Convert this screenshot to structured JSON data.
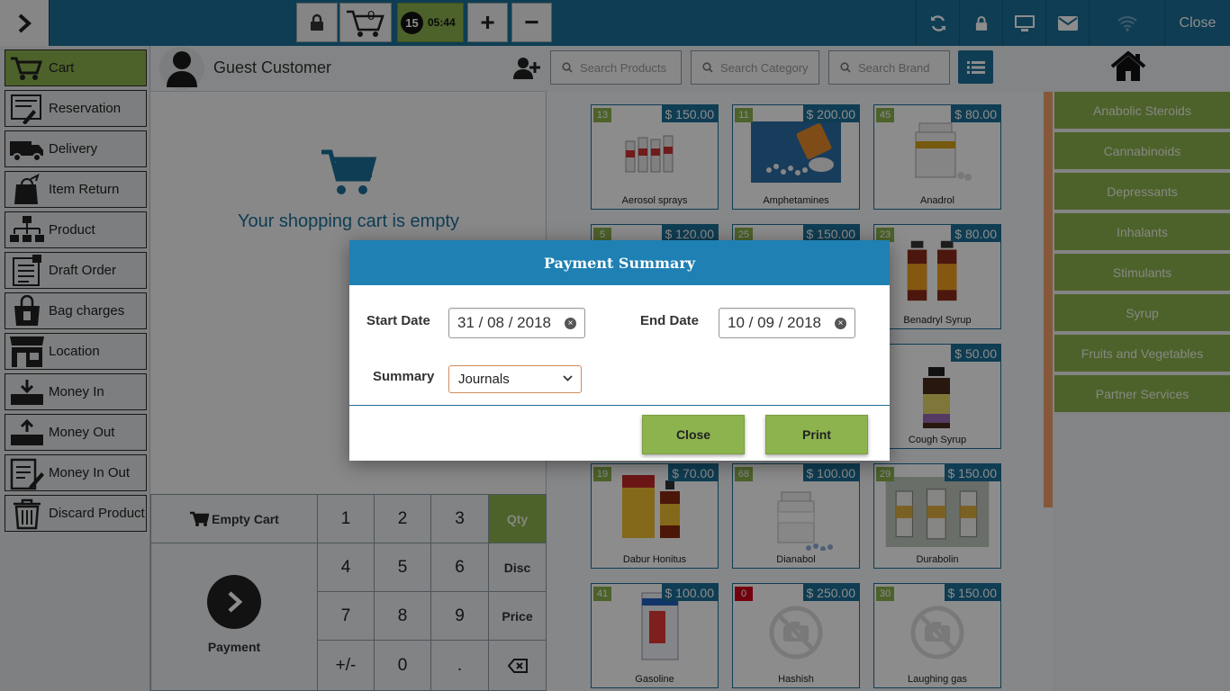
{
  "topbar": {
    "cart_count": "0",
    "order_count": "15",
    "timer": "05:44",
    "plus_label": "+",
    "minus_label": "−",
    "close_label": "Close"
  },
  "sidebar": {
    "items": [
      {
        "label": "Cart",
        "icon": "cart-icon",
        "active": true
      },
      {
        "label": "Reservation",
        "icon": "reservation-icon"
      },
      {
        "label": "Delivery",
        "icon": "delivery-truck-icon"
      },
      {
        "label": "Item Return",
        "icon": "item-return-icon"
      },
      {
        "label": "Product",
        "icon": "product-tree-icon"
      },
      {
        "label": "Draft Order",
        "icon": "draft-order-icon"
      },
      {
        "label": "Bag charges",
        "icon": "bag-icon"
      },
      {
        "label": "Location",
        "icon": "store-icon"
      },
      {
        "label": "Money In",
        "icon": "money-in-icon"
      },
      {
        "label": "Money Out",
        "icon": "money-out-icon"
      },
      {
        "label": "Money In Out",
        "icon": "money-in-out-icon"
      },
      {
        "label": "Discard Product",
        "icon": "trash-icon"
      }
    ]
  },
  "cart": {
    "customer_name": "Guest Customer",
    "empty_message": "Your shopping cart is empty",
    "empty_cart_label": "Empty Cart",
    "payment_label": "Payment"
  },
  "keypad": {
    "keys": [
      "1",
      "2",
      "3",
      "4",
      "5",
      "6",
      "7",
      "8",
      "9",
      "+/-",
      "0",
      "."
    ],
    "side_keys": [
      "Qty",
      "Disc",
      "Price"
    ]
  },
  "search": {
    "products_placeholder": "Search Products",
    "category_placeholder": "Search Category",
    "brand_placeholder": "Search Brand"
  },
  "products": [
    {
      "name": "Aerosol sprays",
      "price": "$ 150.00",
      "stock": "13"
    },
    {
      "name": "Amphetamines",
      "price": "$ 200.00",
      "stock": "11"
    },
    {
      "name": "Anadrol",
      "price": "$ 80.00",
      "stock": "45"
    },
    {
      "name": "",
      "price": "$ 120.00",
      "stock": "5"
    },
    {
      "name": "",
      "price": "$ 150.00",
      "stock": "25"
    },
    {
      "name": "Benadryl Syrup",
      "price": "$ 80.00",
      "stock": "23"
    },
    {
      "name": "",
      "price": "",
      "stock": ""
    },
    {
      "name": "",
      "price": "",
      "stock": ""
    },
    {
      "name": "Cough Syrup",
      "price": "$ 50.00",
      "stock": ""
    },
    {
      "name": "Dabur Honitus",
      "price": "$ 70.00",
      "stock": "19"
    },
    {
      "name": "Dianabol",
      "price": "$ 100.00",
      "stock": "68"
    },
    {
      "name": "Durabolin",
      "price": "$ 150.00",
      "stock": "29"
    },
    {
      "name": "Gasoline",
      "price": "$ 100.00",
      "stock": "41"
    },
    {
      "name": "Hashish",
      "price": "$ 250.00",
      "stock": "0"
    },
    {
      "name": "Laughing gas",
      "price": "$ 150.00",
      "stock": "30"
    }
  ],
  "categories": [
    "Anabolic Steroids",
    "Cannabinoids",
    "Depressants",
    "Inhalants",
    "Stimulants",
    "Syrup",
    "Fruits and Vegetables",
    "Partner Services"
  ],
  "modal": {
    "title": "Payment Summary",
    "start_label": "Start Date",
    "start_value": "31 / 08 / 2018",
    "end_label": "End Date",
    "end_value": "10 / 09 / 2018",
    "summary_label": "Summary",
    "summary_value": "Journals",
    "close_label": "Close",
    "print_label": "Print"
  },
  "colors": {
    "primary": "#1c6f98",
    "accent_green": "#8db34e",
    "modal_header": "#1f80b3"
  }
}
